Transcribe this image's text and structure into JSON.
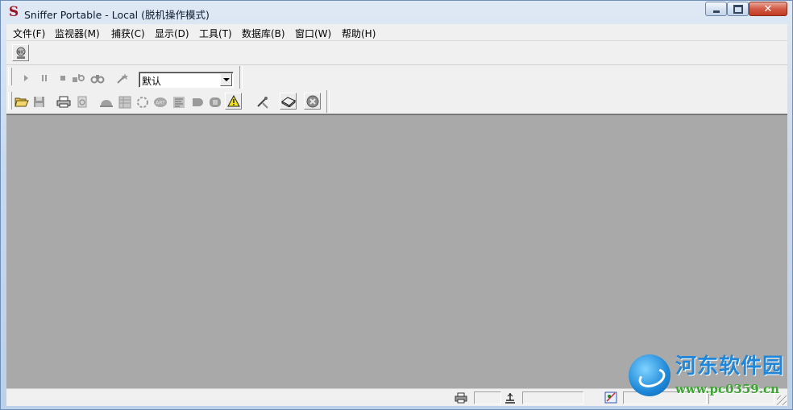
{
  "window": {
    "title": "Sniffer Portable - Local (脱机操作模式)",
    "icon": "sniffer-s-logo",
    "controls": {
      "minimize": "minimize-icon",
      "maximize": "maximize-icon",
      "close": "✕"
    }
  },
  "menu": [
    {
      "label": "文件(F)"
    },
    {
      "label": "监视器(M)"
    },
    {
      "label": "捕获(C)"
    },
    {
      "label": "显示(D)"
    },
    {
      "label": "工具(T)"
    },
    {
      "label": "数据库(B)"
    },
    {
      "label": "窗口(W)"
    },
    {
      "label": "帮助(H)"
    }
  ],
  "toolbar_top": {
    "buttons": [
      {
        "icon": "network-adapter-icon"
      }
    ]
  },
  "toolbar_capture": {
    "buttons": [
      {
        "icon": "play-icon",
        "enabled": false
      },
      {
        "icon": "pause-icon",
        "enabled": false
      },
      {
        "icon": "stop-icon",
        "enabled": false
      },
      {
        "icon": "stop-and-display-icon",
        "enabled": false
      },
      {
        "icon": "display-binoculars-icon",
        "enabled": false
      },
      {
        "icon": "define-filter-icon",
        "enabled": false
      }
    ],
    "filter_select": {
      "value": "默认"
    }
  },
  "toolbar_main": {
    "buttons": [
      {
        "icon": "open-folder-icon",
        "enabled": true
      },
      {
        "icon": "save-disk-icon",
        "enabled": false
      },
      {
        "icon": "print-icon",
        "enabled": true
      },
      {
        "icon": "print-preview-icon",
        "enabled": false
      },
      {
        "icon": "dashboard-icon",
        "enabled": false
      },
      {
        "icon": "host-table-icon",
        "enabled": false
      },
      {
        "icon": "matrix-icon",
        "enabled": false
      },
      {
        "icon": "application-response-time-icon",
        "enabled": false
      },
      {
        "icon": "history-samples-icon",
        "enabled": false
      },
      {
        "icon": "protocol-distribution-icon",
        "enabled": false
      },
      {
        "icon": "global-statistics-icon",
        "enabled": false
      },
      {
        "icon": "alarm-log-icon",
        "enabled": true
      },
      {
        "icon": "address-book-icon",
        "enabled": true
      },
      {
        "icon": "packet-generator-icon",
        "enabled": true
      },
      {
        "icon": "stop-circle-icon",
        "enabled": true
      }
    ]
  },
  "statusbar": {
    "icons": [
      "printer-status-icon",
      "network-status-icon",
      "expert-status-icon"
    ],
    "panels": [
      "",
      "",
      "",
      ""
    ]
  },
  "watermark": {
    "name": "河东软件园",
    "url": "www.pc0359.cn"
  },
  "colors": {
    "workspace": "#a9a9a9",
    "chrome": "#f0f0f0",
    "title_bar": "#c9d9ee",
    "close_button": "#c23a22"
  }
}
